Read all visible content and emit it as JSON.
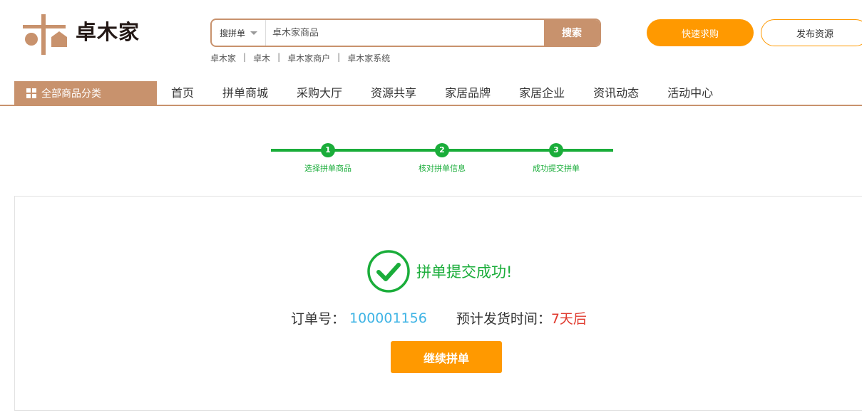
{
  "brand": {
    "name": "卓木家"
  },
  "search": {
    "type_label": "搜拼单",
    "placeholder": "卓木家商品",
    "button_label": "搜索",
    "hot_links": [
      "卓木家",
      "卓木",
      "卓木家商户",
      "卓木家系统"
    ]
  },
  "header_buttons": {
    "quick_purchase": "快速求购",
    "publish_resource": "发布资源"
  },
  "nav": {
    "all_categories": "全部商品分类",
    "items": [
      "首页",
      "拼单商城",
      "采购大厅",
      "资源共享",
      "家居品牌",
      "家居企业",
      "资讯动态",
      "活动中心"
    ]
  },
  "steps": [
    {
      "number": "1",
      "label": "选择拼单商品"
    },
    {
      "number": "2",
      "label": "核对拼单信息"
    },
    {
      "number": "3",
      "label": "成功提交拼单"
    }
  ],
  "result": {
    "message": "拼单提交成功!",
    "order_label": "订单号：",
    "order_number": "100001156",
    "ship_label": "预计发货时间：",
    "ship_value": "7天后",
    "continue_label": "继续拼单"
  },
  "colors": {
    "brand": "#c8926d",
    "accent": "#ff9900",
    "success": "#1aad3a",
    "link_blue": "#3fb4e5",
    "highlight_red": "#e0392d"
  }
}
